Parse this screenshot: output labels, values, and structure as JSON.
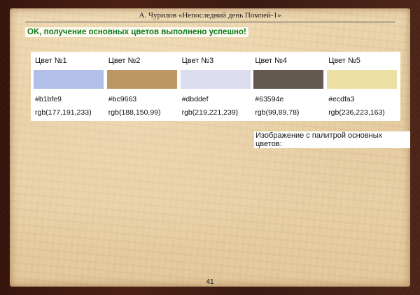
{
  "header": {
    "running_title": "А. Чурилов «Непоследний день Помпей-1»"
  },
  "status": {
    "message": "OK, получение основных цветов выполнено успешно!",
    "color": "#0c7a1a"
  },
  "palette": {
    "colors": [
      {
        "label": "Цвет №1",
        "hex": "#b1bfe9",
        "rgb": "rgb(177,191,233)"
      },
      {
        "label": "Цвет №2",
        "hex": "#bc9663",
        "rgb": "rgb(188,150,99)"
      },
      {
        "label": "Цвет №3",
        "hex": "#dbddef",
        "rgb": "rgb(219,221,239)"
      },
      {
        "label": "Цвет №4",
        "hex": "#63594e",
        "rgb": "rgb(99,89,78)"
      },
      {
        "label": "Цвет №5",
        "hex": "#ecdfa3",
        "rgb": "rgb(236,223,163)"
      }
    ]
  },
  "image_caption": "Изображение с палитрой основных цветов:",
  "footer": {
    "page_number": "41"
  }
}
